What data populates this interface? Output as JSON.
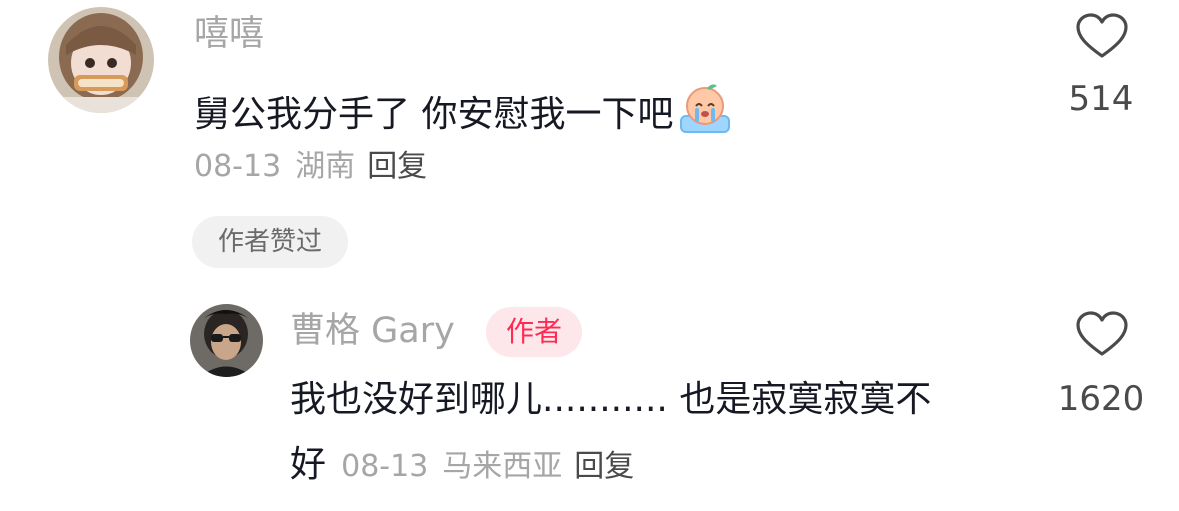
{
  "comment": {
    "username": "嘻嘻",
    "text": "舅公我分手了 你安慰我一下吧",
    "emoji": "crying-emoji",
    "date": "08-13",
    "location": "湖南",
    "reply_label": "回复",
    "liked_by_author_label": "作者赞过",
    "like_count": "514"
  },
  "reply": {
    "username": "曹格 Gary",
    "author_badge": "作者",
    "text_line1": "我也没好到哪儿........... 也是寂寞寂寞不",
    "text_line2": "好",
    "date": "08-13",
    "location": "马来西亚",
    "reply_label": "回复",
    "like_count": "1620"
  },
  "colors": {
    "accent": "#fe2c55",
    "muted": "#a6a6a6",
    "text": "#161823"
  }
}
